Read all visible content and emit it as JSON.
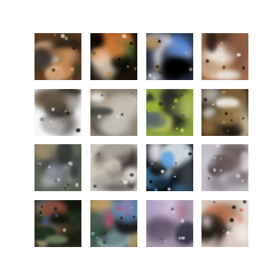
{
  "figure": {
    "rows": 4,
    "cols": 4,
    "background": "#ffffff"
  },
  "samples": [
    {
      "bg": "#5a3a20",
      "colors": [
        "#0c0a08",
        "#c98a55",
        "#a06a35",
        "#e8d8c8",
        "#3a3a2a",
        "#d9a070"
      ]
    },
    {
      "bg": "#1a120a",
      "colors": [
        "#000000",
        "#c87a3a",
        "#6a5a30",
        "#f0e0d0",
        "#3a5a2a",
        "#e07a30"
      ]
    },
    {
      "bg": "#2a3040",
      "colors": [
        "#000000",
        "#5a8ad8",
        "#e8e8f0",
        "#30344a",
        "#b89060",
        "#cfd6e0"
      ]
    },
    {
      "bg": "#a07050",
      "colors": [
        "#c8a888",
        "#2a1a10",
        "#d8b890",
        "#6a3a2a",
        "#f0e8e0",
        "#8a5a40"
      ]
    },
    {
      "bg": "#f4f4f4",
      "colors": [
        "#1a1612",
        "#5a4a3a",
        "#ffffff",
        "#2a2420",
        "#8a7a6a",
        "#e0dcd8"
      ]
    },
    {
      "bg": "#8a8070",
      "colors": [
        "#d8d4cc",
        "#3a3a3a",
        "#f0eeea",
        "#a89a88",
        "#6a6258",
        "#c8c0b4"
      ]
    },
    {
      "bg": "#8aa040",
      "colors": [
        "#2a2a2a",
        "#c8d060",
        "#4a5a6a",
        "#a0b838",
        "#1a1a1a",
        "#707a50"
      ]
    },
    {
      "bg": "#3a2a18",
      "colors": [
        "#8a6a40",
        "#f0ece8",
        "#1a1208",
        "#b08a50",
        "#5a5a3a",
        "#d8c8a8"
      ]
    },
    {
      "bg": "#5a6050",
      "colors": [
        "#2a2e2a",
        "#8a9098",
        "#c8ccd0",
        "#3a3a40",
        "#9a8a6a",
        "#6a7068"
      ]
    },
    {
      "bg": "#c8c4bc",
      "colors": [
        "#a8a49c",
        "#3a3230",
        "#e8e4e0",
        "#6a6058",
        "#d8d0c0",
        "#8a8078"
      ]
    },
    {
      "bg": "#0c1014",
      "colors": [
        "#000000",
        "#5aa0e0",
        "#f4f4f8",
        "#1a2028",
        "#d0d8e0",
        "#3a4048"
      ]
    },
    {
      "bg": "#c0bcc4",
      "colors": [
        "#e0dce4",
        "#6a5a5a",
        "#a8a0a8",
        "#4a3a38",
        "#d0ccd4",
        "#8a8088"
      ]
    },
    {
      "bg": "#2a3020",
      "colors": [
        "#101208",
        "#6a7a5a",
        "#3a5aa0",
        "#8a4a3a",
        "#c8b898",
        "#1a2a18"
      ]
    },
    {
      "bg": "#4a5a50",
      "colors": [
        "#1a1a1a",
        "#6a9ad0",
        "#c8a060",
        "#2a4a3a",
        "#d04a6a",
        "#8aaab0"
      ]
    },
    {
      "bg": "#a89ab0",
      "colors": [
        "#d8c8e8",
        "#5a4a60",
        "#e8e0f0",
        "#8a3a4a",
        "#2a2a3a",
        "#b0a0c0"
      ]
    },
    {
      "bg": "#d8c8c0",
      "colors": [
        "#2a2018",
        "#f0ece8",
        "#8a6a50",
        "#c86a40",
        "#1a1410",
        "#e8dcd4"
      ]
    }
  ]
}
